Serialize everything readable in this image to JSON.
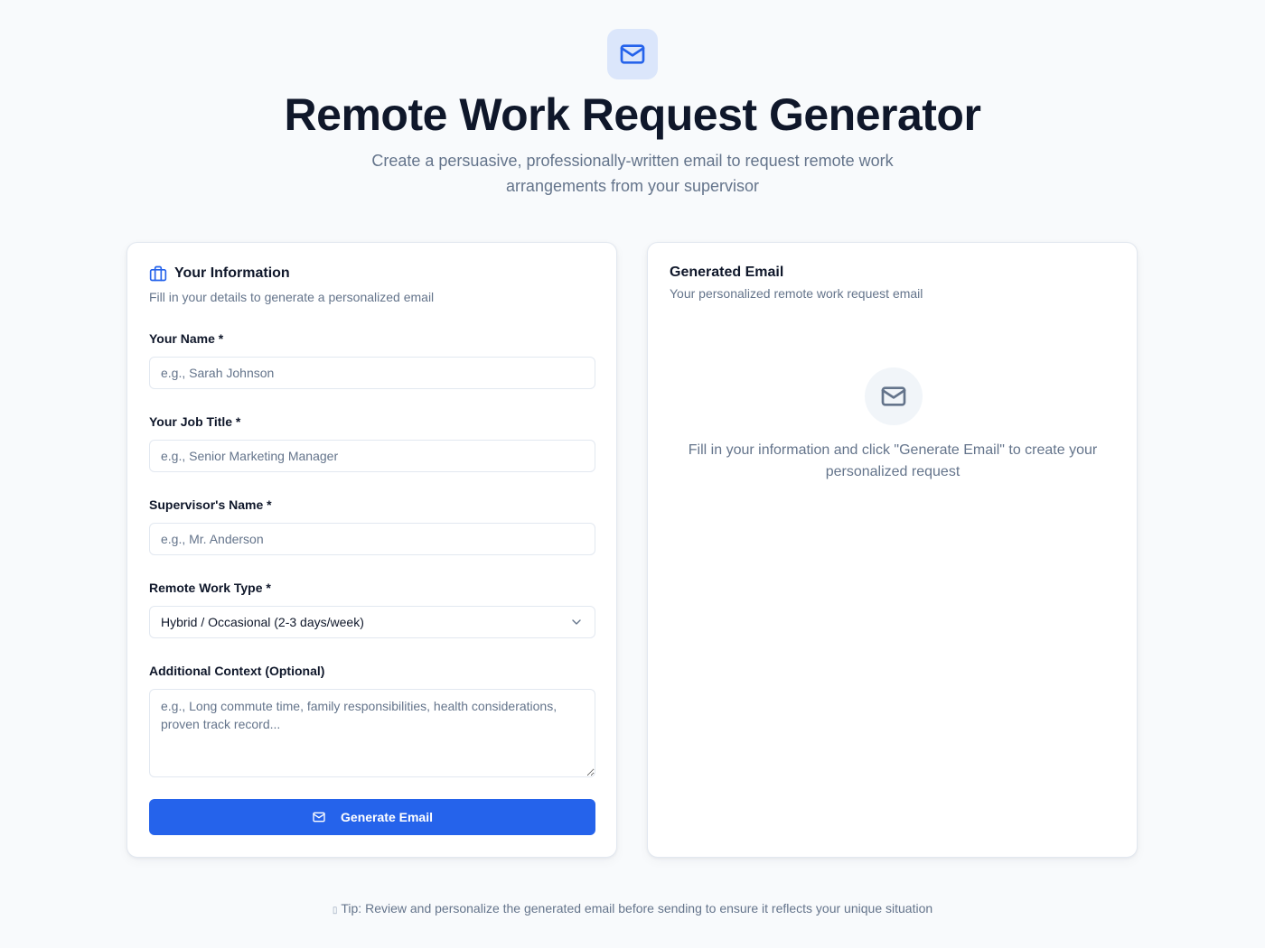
{
  "header": {
    "title": "Remote Work Request Generator",
    "subtitle": "Create a persuasive, professionally-written email to request remote work arrangements from your supervisor",
    "logo_icon": "mail-icon"
  },
  "form": {
    "title": "Your Information",
    "title_icon": "briefcase-icon",
    "description": "Fill in your details to generate a personalized email",
    "fields": {
      "name": {
        "label": "Your Name *",
        "placeholder": "e.g., Sarah Johnson",
        "value": ""
      },
      "job_title": {
        "label": "Your Job Title *",
        "placeholder": "e.g., Senior Marketing Manager",
        "value": ""
      },
      "supervisor": {
        "label": "Supervisor's Name *",
        "placeholder": "e.g., Mr. Anderson",
        "value": ""
      },
      "work_type": {
        "label": "Remote Work Type *",
        "selected": "Hybrid / Occasional (2-3 days/week)"
      },
      "context": {
        "label": "Additional Context (Optional)",
        "placeholder": "e.g., Long commute time, family responsibilities, health considerations, proven track record...",
        "value": ""
      }
    },
    "submit_label": "Generate Email"
  },
  "output": {
    "title": "Generated Email",
    "description": "Your personalized remote work request email",
    "empty_message": "Fill in your information and click \"Generate Email\" to create your personalized request"
  },
  "footer": {
    "tip": "Tip: Review and personalize the generated email before sending to ensure it reflects your unique situation"
  },
  "colors": {
    "accent": "#2563eb",
    "background": "#f8fafc",
    "muted_text": "#64748b"
  }
}
